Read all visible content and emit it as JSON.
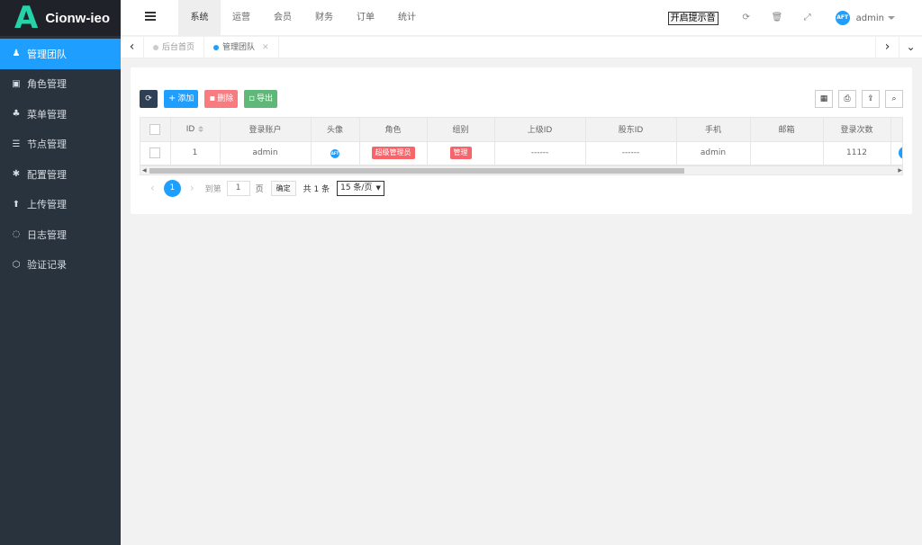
{
  "brand": {
    "mark": "A",
    "name": "Cionw-ieo",
    "mark_color": "#26d3a8"
  },
  "sidebar": {
    "items": [
      {
        "label": "管理团队",
        "icon": "user-icon",
        "glyph": "♟",
        "active": true
      },
      {
        "label": "角色管理",
        "icon": "role-icon",
        "glyph": "▣",
        "active": false
      },
      {
        "label": "菜单管理",
        "icon": "tree-icon",
        "glyph": "♣",
        "active": false
      },
      {
        "label": "节点管理",
        "icon": "list-icon",
        "glyph": "☰",
        "active": false
      },
      {
        "label": "配置管理",
        "icon": "asterisk-icon",
        "glyph": "✱",
        "active": false
      },
      {
        "label": "上传管理",
        "icon": "upload-arrow-icon",
        "glyph": "⬆",
        "active": false
      },
      {
        "label": "日志管理",
        "icon": "log-icon",
        "glyph": "◌",
        "active": false
      },
      {
        "label": "验证记录",
        "icon": "cube-icon",
        "glyph": "⬡",
        "active": false
      }
    ]
  },
  "header": {
    "nav": [
      "系统",
      "运营",
      "会员",
      "财务",
      "订单",
      "统计"
    ],
    "active_nav": "系统",
    "sound_button": "开启提示音",
    "avatar_text": "AFT",
    "username": "admin"
  },
  "tabs": {
    "items": [
      {
        "label": "后台首页",
        "active": false,
        "closable": false
      },
      {
        "label": "管理团队",
        "active": true,
        "closable": true
      }
    ]
  },
  "toolbar": {
    "add": "添加",
    "delete": "删除",
    "export": "导出"
  },
  "table": {
    "columns": [
      "",
      "ID",
      "登录账户",
      "头像",
      "角色",
      "组别",
      "上级ID",
      "股东ID",
      "手机",
      "邮箱",
      "登录次数",
      ""
    ],
    "rows": [
      {
        "id": "1",
        "account": "admin",
        "avatar": "AFT",
        "role": "超级管理员",
        "group": "管理",
        "parent_id": "------",
        "holder_id": "------",
        "phone": "admin",
        "email": "",
        "login_count": "1112"
      }
    ]
  },
  "pagination": {
    "current_page": "1",
    "goto_label": "到第",
    "goto_value": "1",
    "page_unit": "页",
    "confirm": "确定",
    "total": "共 1 条",
    "page_size": "15 条/页"
  },
  "colors": {
    "primary": "#1e9fff",
    "sidebar_bg": "#28333e",
    "danger": "#f7646a",
    "success": "#5fb878",
    "dark": "#2f4056"
  }
}
